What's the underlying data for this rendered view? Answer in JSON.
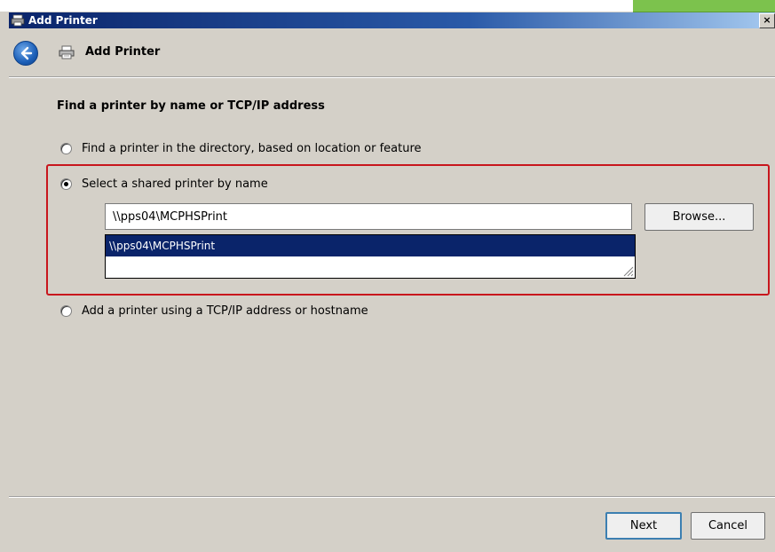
{
  "window": {
    "title": "Add Printer",
    "close_label": "×"
  },
  "header": {
    "title": "Add Printer"
  },
  "page": {
    "heading": "Find a printer by name or TCP/IP address",
    "options": [
      {
        "label": "Find a printer in the directory, based on location or feature",
        "checked": false
      },
      {
        "label": "Select a shared printer by name",
        "checked": true
      },
      {
        "label": "Add a printer using a TCP/IP address or hostname",
        "checked": false
      }
    ],
    "printer_name": {
      "value": "\\\\pps04\\MCPHSPrint",
      "suggestions": [
        "\\\\pps04\\MCPHSPrint"
      ],
      "browse_label": "Browse..."
    }
  },
  "footer": {
    "next_label": "Next",
    "cancel_label": "Cancel"
  },
  "colors": {
    "highlight_border": "#c8161d",
    "selection": "#0a246a",
    "titlebar": "#0a246a"
  }
}
